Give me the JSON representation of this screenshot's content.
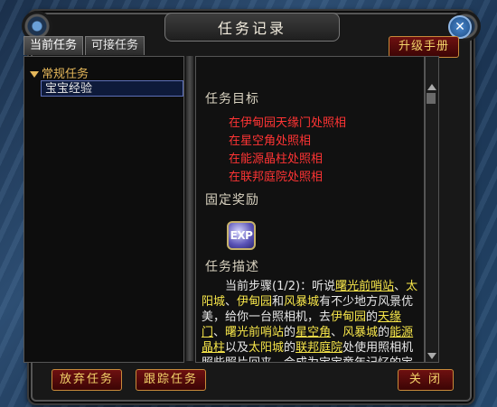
{
  "window": {
    "title": "任务记录"
  },
  "tabs": [
    {
      "label": "当前任务",
      "active": true
    },
    {
      "label": "可接任务",
      "active": false
    }
  ],
  "upgrade_button": "升级手册",
  "task_tree": {
    "category": "常规任务",
    "items": [
      {
        "label": "宝宝经验",
        "selected": true
      }
    ]
  },
  "details": {
    "goal_title": "任务目标",
    "goals": [
      "在伊甸园天缘门处照相",
      "在星空角处照相",
      "在能源晶柱处照相",
      "在联邦庭院处照相"
    ],
    "reward_title": "固定奖励",
    "reward_icon": {
      "name": "exp-icon",
      "label": "EXP"
    },
    "desc_title": "任务描述",
    "desc_parts": [
      {
        "text": "当前步骤(1/2)：听说",
        "style": "n"
      },
      {
        "text": "曙光前哨站",
        "style": "hlu"
      },
      {
        "text": "、",
        "style": "n"
      },
      {
        "text": "太阳城",
        "style": "hl"
      },
      {
        "text": "、",
        "style": "n"
      },
      {
        "text": "伊甸园",
        "style": "hl"
      },
      {
        "text": "和",
        "style": "n"
      },
      {
        "text": "风暴城",
        "style": "hl"
      },
      {
        "text": "有不少地方风景优美，给你一台照相机，去",
        "style": "n"
      },
      {
        "text": "伊甸园",
        "style": "hl"
      },
      {
        "text": "的",
        "style": "n"
      },
      {
        "text": "天缘门",
        "style": "hlu"
      },
      {
        "text": "、",
        "style": "n"
      },
      {
        "text": "曙光前哨站",
        "style": "hl"
      },
      {
        "text": "的",
        "style": "n"
      },
      {
        "text": "星空角",
        "style": "hlu"
      },
      {
        "text": "、",
        "style": "n"
      },
      {
        "text": "风暴城",
        "style": "hl"
      },
      {
        "text": "的",
        "style": "n"
      },
      {
        "text": "能源晶柱",
        "style": "hlu"
      },
      {
        "text": "以及",
        "style": "n"
      },
      {
        "text": "太阳城",
        "style": "hl"
      },
      {
        "text": "的",
        "style": "n"
      },
      {
        "text": "联邦庭院",
        "style": "hlu"
      },
      {
        "text": "处使用照相机照些照片回来，会成为宝宝童年记忆的宝",
        "style": "n"
      }
    ]
  },
  "buttons": {
    "abandon": "放弃任务",
    "track": "跟踪任务",
    "close": "关 闭"
  },
  "colors": {
    "goal": "#ff3434",
    "highlight": "#f7e64a",
    "button_text": "#f3d36a"
  }
}
